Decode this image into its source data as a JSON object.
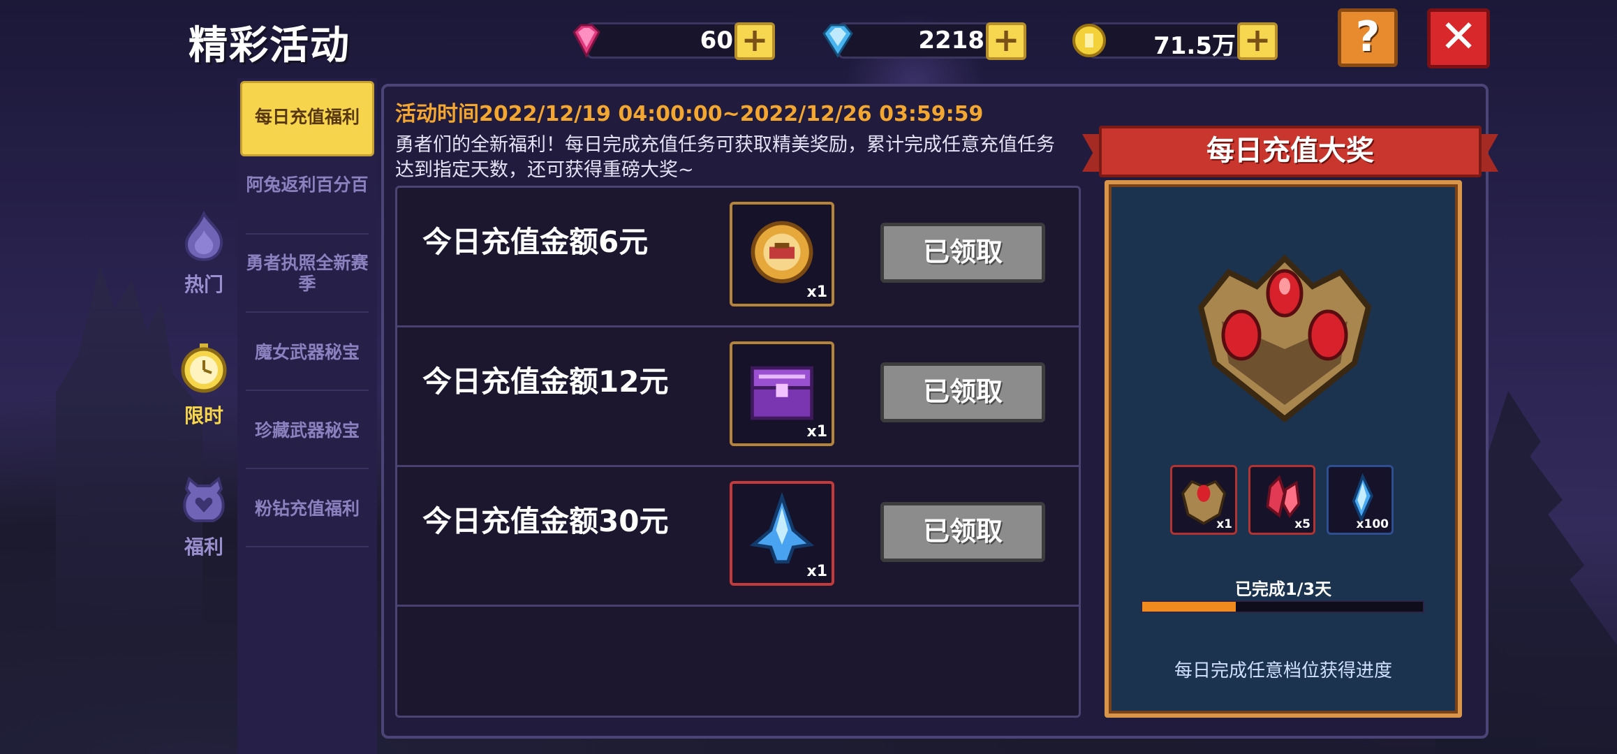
{
  "title": "精彩活动",
  "currencies": [
    {
      "name": "pink-gem",
      "value": "60",
      "color": "#e0397d"
    },
    {
      "name": "blue-gem",
      "value": "2218",
      "color": "#49b5f0"
    },
    {
      "name": "gold-coin",
      "value": "71.5万",
      "color": "#f3d13b"
    }
  ],
  "buttons": {
    "help": "?",
    "close": "✕"
  },
  "categories": [
    {
      "label": "热门",
      "icon": "flame-icon",
      "active": false
    },
    {
      "label": "限时",
      "icon": "stopwatch-icon",
      "active": true
    },
    {
      "label": "福利",
      "icon": "heart-bag-icon",
      "active": false
    }
  ],
  "tabs": [
    {
      "label": "每日充值福利",
      "active": true
    },
    {
      "label": "阿兔返利百分百",
      "active": false
    },
    {
      "label": "勇者执照全新赛季",
      "active": false
    },
    {
      "label": "魔女武器秘宝",
      "active": false
    },
    {
      "label": "珍藏武器秘宝",
      "active": false
    },
    {
      "label": "粉钻充值福利",
      "active": false
    }
  ],
  "event": {
    "time": "活动时间2022/12/19 04:00:00~2022/12/26 03:59:59",
    "description": "勇者们的全新福利！每日完成充值任务可获取精美奖励，累计完成任意充值任务达到指定天数，还可获得重磅大奖~"
  },
  "tasks": [
    {
      "title": "今日充值金额6元",
      "item_icon": "golden-badge-icon",
      "quantity": "x1",
      "status": "已领取"
    },
    {
      "title": "今日充值金额12元",
      "item_icon": "purple-chest-icon",
      "quantity": "x1",
      "status": "已领取"
    },
    {
      "title": "今日充值金额30元",
      "item_icon": "blue-spaceship-icon",
      "quantity": "x1",
      "status": "已领取"
    }
  ],
  "grand_prize": {
    "title": "每日充值大奖",
    "main_icon": "ruby-treasure-chest-icon",
    "items": [
      {
        "icon": "ruby-chest-icon",
        "quantity": "x1"
      },
      {
        "icon": "red-crystal-icon",
        "quantity": "x5"
      },
      {
        "icon": "blue-crystal-icon",
        "quantity": "x100"
      }
    ],
    "progress_label": "已完成1/3天",
    "progress": 0.333,
    "hint": "每日完成任意档位获得进度"
  }
}
